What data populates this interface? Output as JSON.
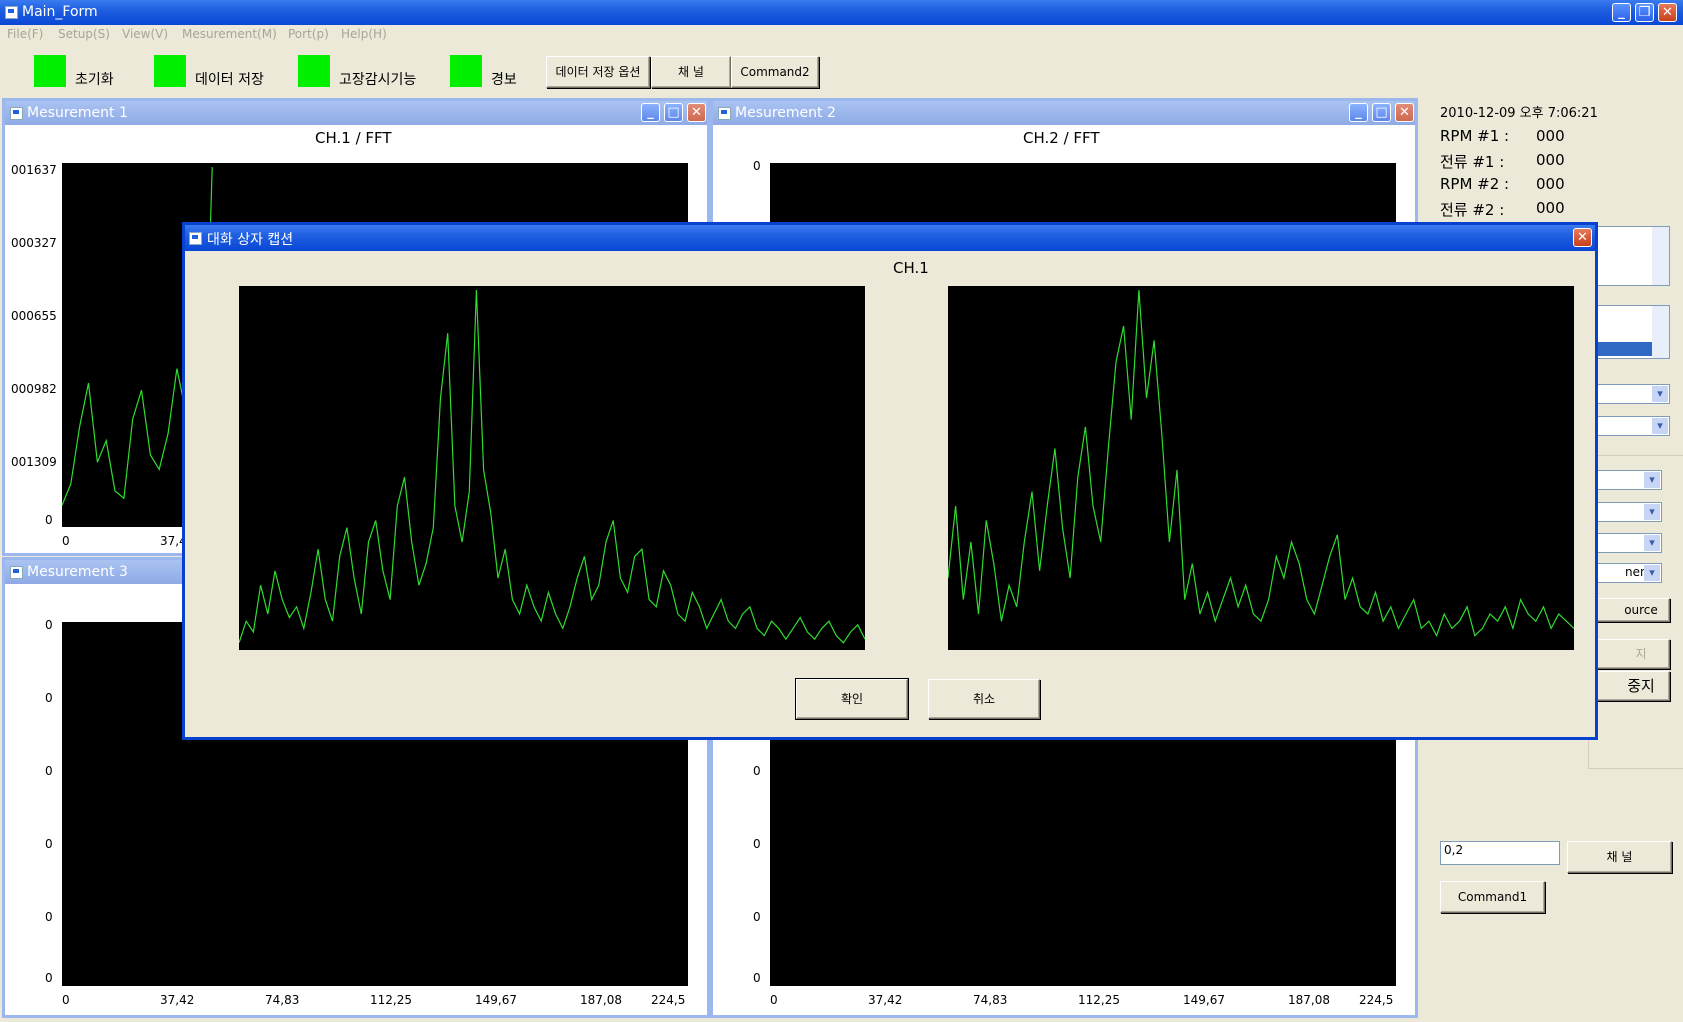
{
  "main_window": {
    "title": "Main_Form",
    "menu": [
      "File(F)",
      "Setup(S)",
      "View(V)",
      "Mesurement(M)",
      "Port(p)",
      "Help(H)"
    ]
  },
  "toolbar": {
    "indicators": [
      "초기화",
      "데이터 저장",
      "고장감시기능",
      "경보"
    ],
    "buttons": [
      "데이터 저장 옵션",
      "채 널",
      "Command2"
    ]
  },
  "children": {
    "m1": {
      "title": "Mesurement 1",
      "plot_title": "CH.1  /  FFT",
      "ylabels": [
        "001637",
        "000327",
        "000655",
        "000982",
        "001309",
        "0"
      ],
      "xlabels": [
        "0",
        "37,4"
      ]
    },
    "m2": {
      "title": "Mesurement 2",
      "plot_title": "CH.2  /  FFT",
      "ylabels": [
        "0"
      ]
    },
    "m3": {
      "title": "Mesurement 3",
      "ylabels": [
        "0",
        "0",
        "0",
        "0",
        "0",
        "0"
      ],
      "xlabels": [
        "0",
        "37,42",
        "74,83",
        "112,25",
        "149,67",
        "187,08",
        "224,5"
      ]
    },
    "m4": {
      "ylabels": [
        "0",
        "0",
        "0",
        "0"
      ],
      "xlabels": [
        "0",
        "37,42",
        "74,83",
        "112,25",
        "149,67",
        "187,08",
        "224,5"
      ]
    }
  },
  "panel": {
    "datetime": "2010-12-09 오후 7:06:21",
    "readouts": [
      {
        "label": "RPM #1 :",
        "value": "000"
      },
      {
        "label": "전류 #1 :",
        "value": "000"
      },
      {
        "label": "RPM #2 :",
        "value": "000"
      },
      {
        "label": "전류 #2 :",
        "value": "000"
      }
    ],
    "partial_labels": [
      "nen",
      "ource",
      "지",
      "중지"
    ],
    "input_value": "0,2",
    "channel_button": "채 널",
    "command1_button": "Command1"
  },
  "dialog": {
    "title": "대화 상자 캡션",
    "chart_title": "CH.1",
    "ok": "확인",
    "cancel": "취소"
  },
  "chart_data": [
    {
      "type": "line",
      "title": "CH.1",
      "description_series": "left dialog spectrum",
      "series": [
        {
          "values": [
            2,
            8,
            5,
            18,
            10,
            22,
            14,
            9,
            12,
            6,
            16,
            28,
            14,
            8,
            26,
            34,
            20,
            10,
            30,
            36,
            22,
            14,
            40,
            48,
            30,
            18,
            24,
            34,
            70,
            88,
            40,
            30,
            44,
            100,
            50,
            38,
            20,
            28,
            14,
            10,
            18,
            12,
            8,
            16,
            10,
            6,
            12,
            20,
            26,
            14,
            18,
            30,
            36,
            20,
            16,
            26,
            28,
            14,
            12,
            22,
            18,
            10,
            8,
            16,
            12,
            6,
            10,
            14,
            8,
            6,
            10,
            12,
            6,
            4,
            8,
            6,
            3,
            6,
            9,
            5,
            3,
            6,
            8,
            4,
            2,
            5,
            7,
            3
          ]
        }
      ]
    },
    {
      "type": "line",
      "series": [
        {
          "values": [
            20,
            40,
            14,
            30,
            10,
            36,
            24,
            8,
            18,
            12,
            30,
            44,
            22,
            40,
            56,
            34,
            20,
            48,
            62,
            40,
            30,
            56,
            80,
            90,
            64,
            100,
            70,
            86,
            60,
            30,
            50,
            14,
            24,
            10,
            16,
            8,
            14,
            20,
            12,
            18,
            10,
            8,
            14,
            26,
            20,
            30,
            24,
            14,
            10,
            18,
            26,
            32,
            14,
            20,
            12,
            10,
            16,
            8,
            12,
            6,
            10,
            14,
            6,
            8,
            4,
            10,
            6,
            8,
            12,
            4,
            6,
            10,
            8,
            12,
            6,
            14,
            10,
            8,
            12,
            6,
            10,
            8,
            6
          ]
        }
      ]
    },
    {
      "type": "line",
      "title": "CH.1  /  FFT",
      "y_ticks": [
        "001637",
        "000327",
        "000655",
        "000982",
        "001309",
        "0"
      ],
      "series": [
        {
          "values": [
            6,
            12,
            28,
            40,
            18,
            24,
            10,
            8,
            30,
            38,
            20,
            16,
            26,
            44,
            32,
            10,
            18,
            100
          ]
        }
      ]
    }
  ]
}
